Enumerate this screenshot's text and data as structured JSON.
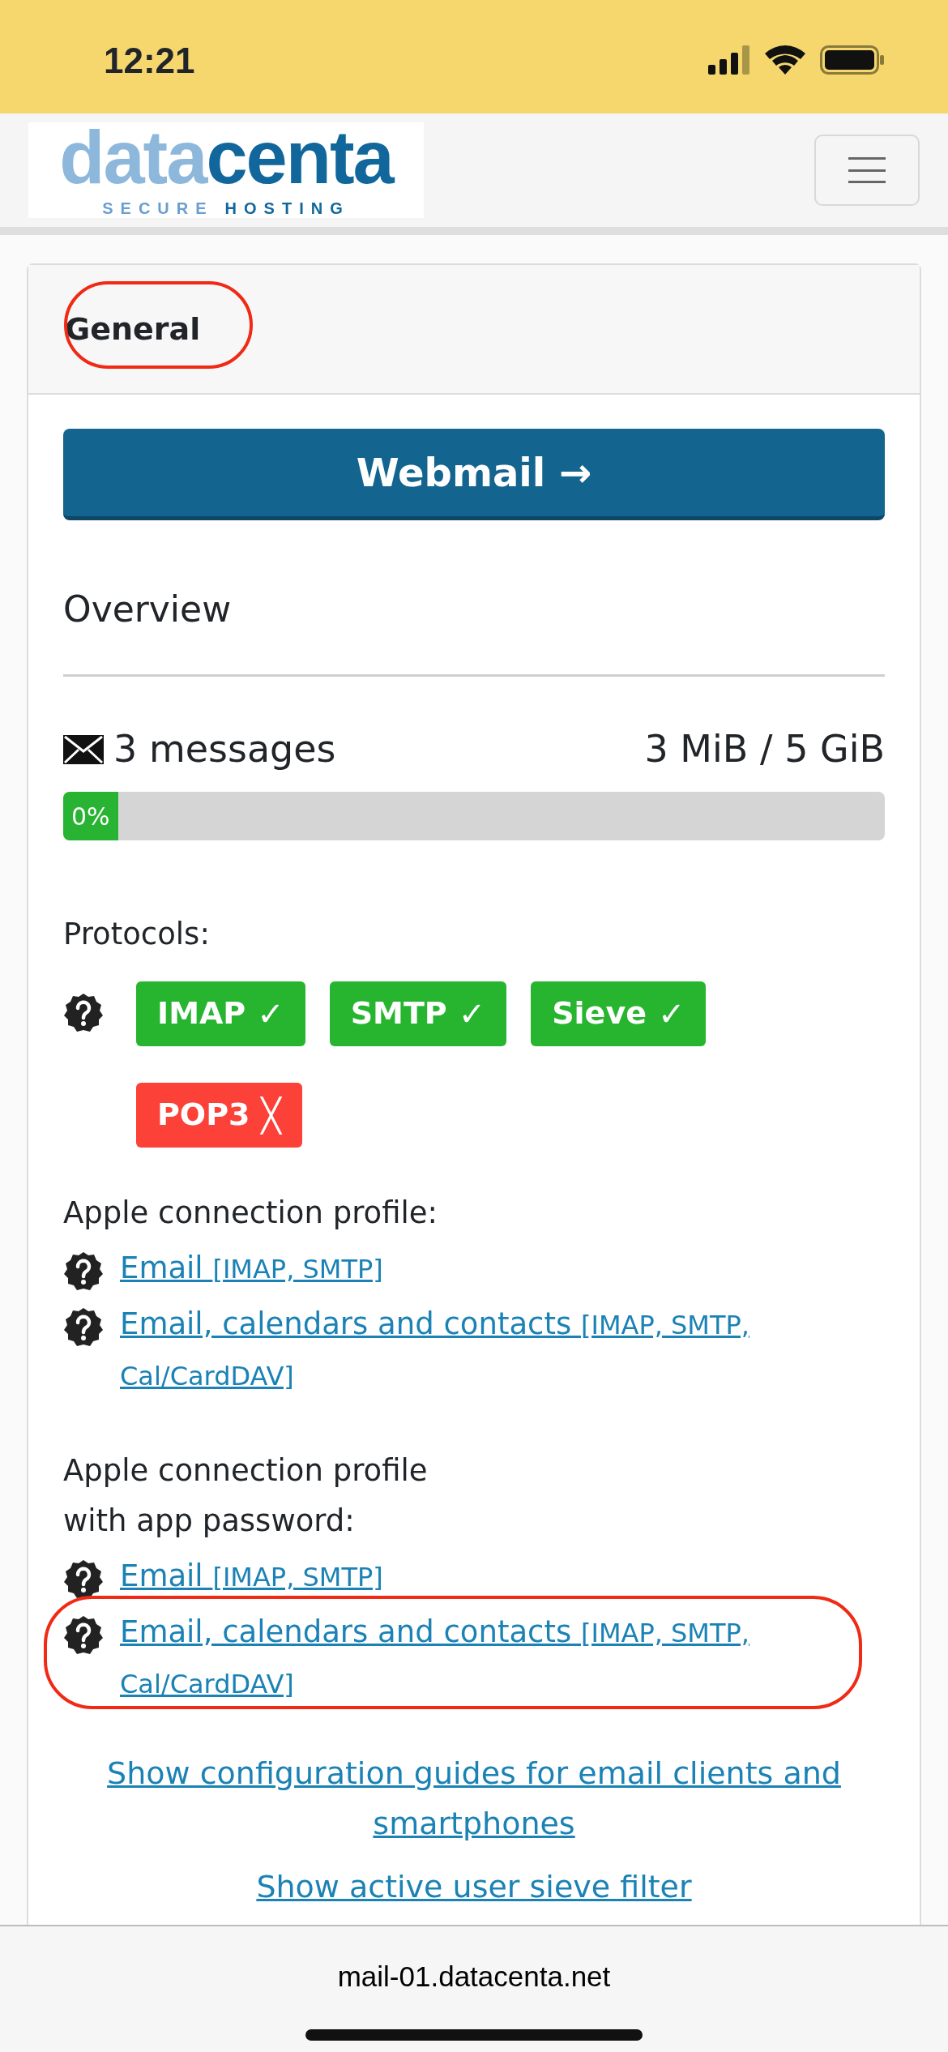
{
  "status_bar": {
    "time": "12:21"
  },
  "navbar": {
    "logo": {
      "light": "data",
      "dark": "centa",
      "tagline_light": "SECURE",
      "tagline_dark": "HOSTING"
    }
  },
  "card": {
    "header": {
      "title": "General",
      "highlighted": true
    },
    "webmail_button": "Webmail →",
    "overview_title": "Overview",
    "messages": "3 messages",
    "quota": "3 MiB / 5 GiB",
    "usage": {
      "level": 0,
      "label": "0%"
    },
    "protocols_label": "Protocols:",
    "protocols": [
      {
        "name": "IMAP",
        "enabled": true,
        "symbol": "✓"
      },
      {
        "name": "SMTP",
        "enabled": true,
        "symbol": "✓"
      },
      {
        "name": "Sieve",
        "enabled": true,
        "symbol": "✓"
      },
      {
        "name": "POP3",
        "enabled": false,
        "symbol": "╳"
      }
    ],
    "profile_groups": [
      {
        "title_lines": [
          "Apple connection profile:"
        ],
        "links": [
          {
            "label": "Email",
            "detail": "[IMAP, SMTP]",
            "highlighted": false
          },
          {
            "label": "Email, calendars and contacts",
            "detail": "[IMAP, SMTP, Cal/CardDAV]",
            "highlighted": false
          }
        ]
      },
      {
        "title_lines": [
          "Apple connection profile",
          "with app password:"
        ],
        "links": [
          {
            "label": "Email",
            "detail": "[IMAP, SMTP]",
            "highlighted": false
          },
          {
            "label": "Email, calendars and contacts",
            "detail": "[IMAP, SMTP, Cal/CardDAV]",
            "highlighted": true
          }
        ]
      }
    ],
    "footer_links": [
      "Show configuration guides for email clients and smartphones",
      "Show active user sieve filter"
    ]
  },
  "address_bar": {
    "url": "mail-01.datacenta.net"
  }
}
